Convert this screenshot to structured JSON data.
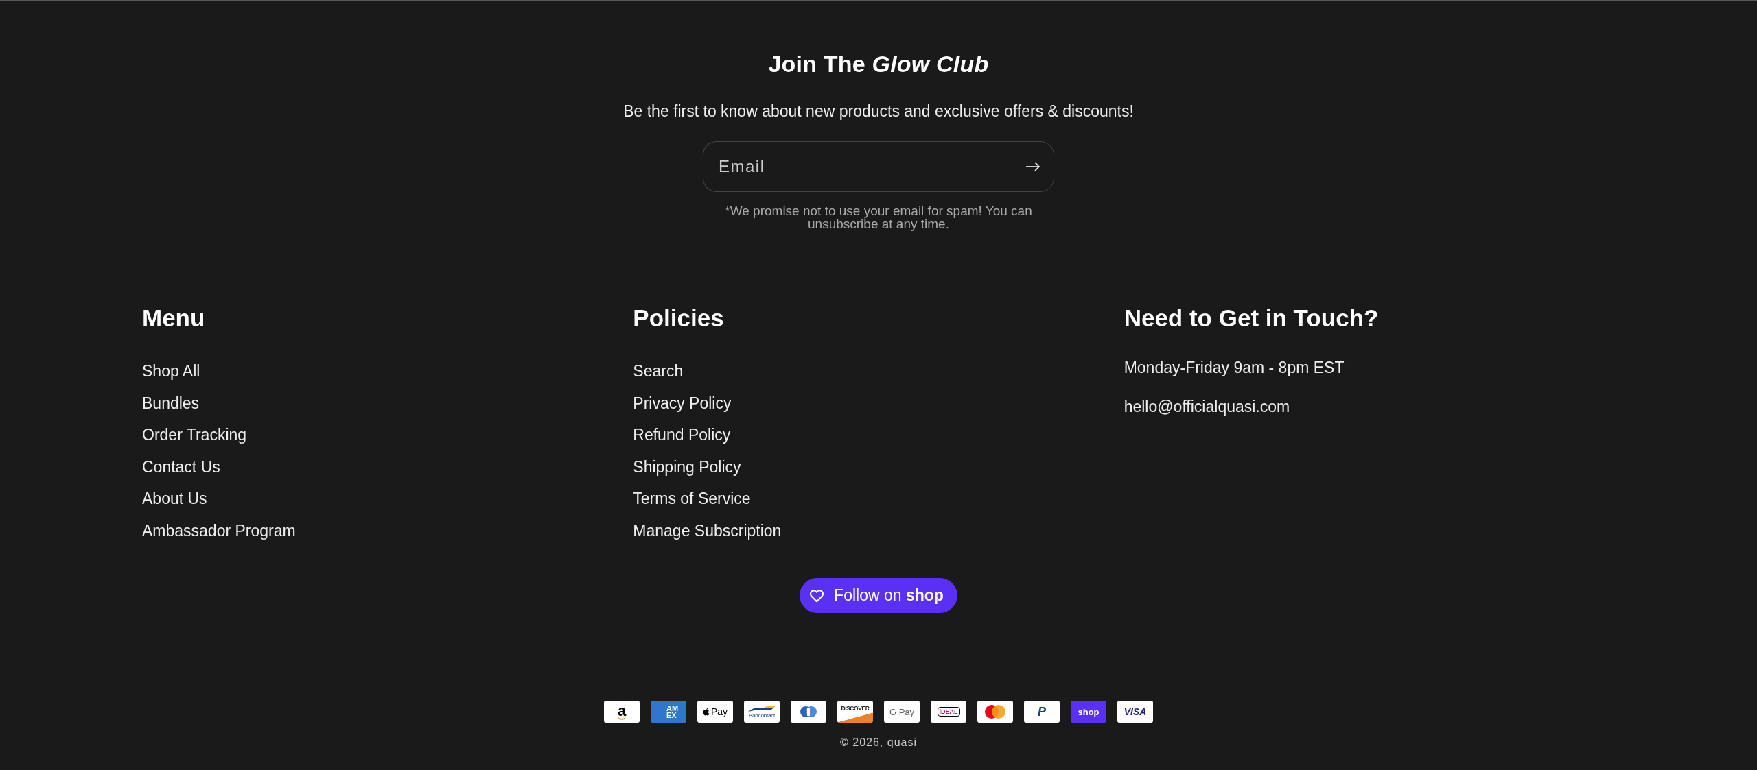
{
  "newsletter": {
    "title": "Join The *Glow Club*",
    "subtitle": "Be the first to know about new products and exclusive offers & discounts!",
    "email": {
      "placeholder": "Email"
    },
    "note": "*We promise not to use your email for spam! You can unsubscribe at any time."
  },
  "columns": [
    {
      "heading": "Menu",
      "kind": "links",
      "items": [
        "Shop All",
        "Bundles",
        "Order Tracking",
        "Contact Us",
        "About Us",
        "Ambassador Program"
      ]
    },
    {
      "heading": "Policies",
      "kind": "links",
      "items": [
        "Search",
        "Privacy Policy",
        "Refund Policy",
        "Shipping Policy",
        "Terms of Service",
        "Manage Subscription"
      ]
    },
    {
      "heading": "Need to Get in Touch?",
      "kind": "text",
      "items": [
        "Monday-Friday 9am - 8pm EST",
        "hello@officialquasi.com"
      ]
    }
  ],
  "follow_button": "Follow on **shop**",
  "payment_icons": [
    {
      "kind": "amazon",
      "label": "a"
    },
    {
      "kind": "amex",
      "label": "AM EX"
    },
    {
      "kind": "applepay",
      "label": "Pay"
    },
    {
      "kind": "bancontact",
      "label": "Bancontact"
    },
    {
      "kind": "diners"
    },
    {
      "kind": "discover",
      "label": "DISCOVER"
    },
    {
      "kind": "googlepay",
      "label": "G Pay"
    },
    {
      "kind": "ideal",
      "label": "iDEAL"
    },
    {
      "kind": "mastercard"
    },
    {
      "kind": "paypal",
      "label": "P"
    },
    {
      "kind": "shoppay",
      "label": "shop"
    },
    {
      "kind": "visa",
      "label": "VISA"
    }
  ],
  "copyright": "© 2026, quasi"
}
